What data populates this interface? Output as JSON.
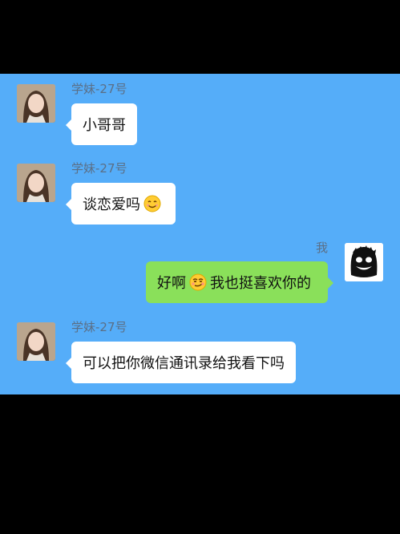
{
  "messages": [
    {
      "side": "left",
      "sender": "学妹-27号",
      "text": "小哥哥",
      "emoji": null
    },
    {
      "side": "left",
      "sender": "学妹-27号",
      "text": "谈恋爱吗",
      "emoji": "smiling-face-emoji"
    },
    {
      "side": "right",
      "sender": "我",
      "text_before": "好啊",
      "emoji": "smirking-face-emoji",
      "text_after": "我也挺喜欢你的"
    },
    {
      "side": "left",
      "sender": "学妹-27号",
      "text": "可以把你微信通讯录给我看下吗",
      "emoji": null
    }
  ],
  "colors": {
    "chat_background": "#55adf9",
    "incoming_bubble": "#ffffff",
    "outgoing_bubble": "#8ae05a",
    "sender_name": "#5b6f86"
  }
}
